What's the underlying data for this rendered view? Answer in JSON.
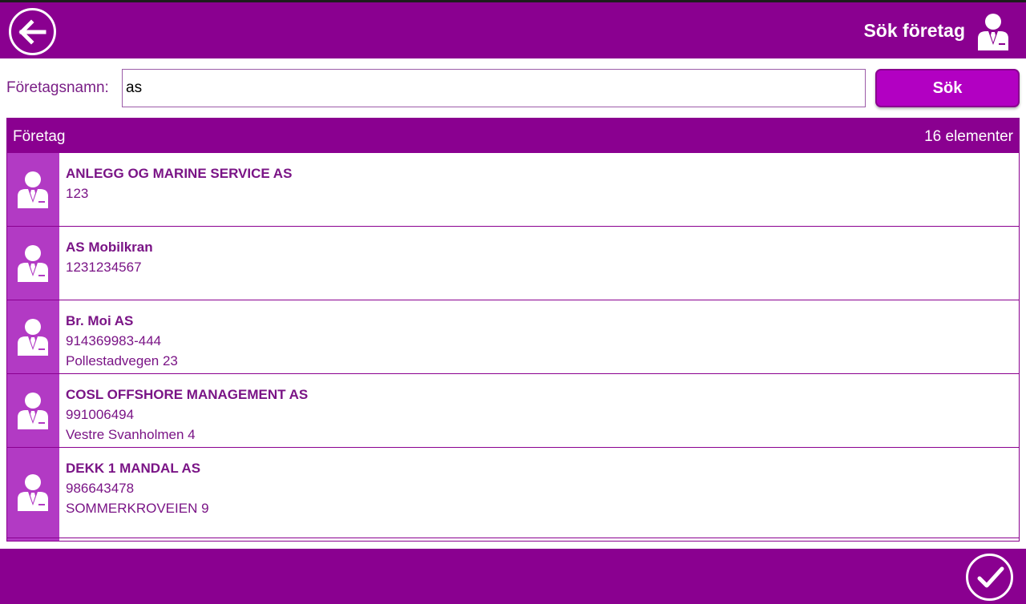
{
  "header": {
    "title": "Sök företag",
    "back_icon": "arrow-left-icon",
    "title_icon": "businessman-icon"
  },
  "search": {
    "label": "Företagsnamn:",
    "value": "as",
    "button_label": "Sök"
  },
  "list": {
    "column_title": "Företag",
    "count_label": "16 elementer",
    "items": [
      {
        "name": "ANLEGG OG MARINE SERVICE AS",
        "number": "123",
        "address": ""
      },
      {
        "name": "AS Mobilkran",
        "number": "1231234567",
        "address": ""
      },
      {
        "name": "Br. Moi AS",
        "number": "914369983-444",
        "address": "Pollestadvegen 23"
      },
      {
        "name": "COSL OFFSHORE MANAGEMENT AS",
        "number": "991006494",
        "address": "Vestre Svanholmen 4"
      },
      {
        "name": "DEKK 1 MANDAL AS",
        "number": "986643478",
        "address": "SOMMERKROVEIEN 9"
      }
    ]
  },
  "footer": {
    "confirm_icon": "checkmark-icon"
  },
  "colors": {
    "primary": "#8a0090",
    "accent_button": "#b200c2",
    "avatar_cell": "#b23ac4",
    "text": "#7a1486"
  }
}
